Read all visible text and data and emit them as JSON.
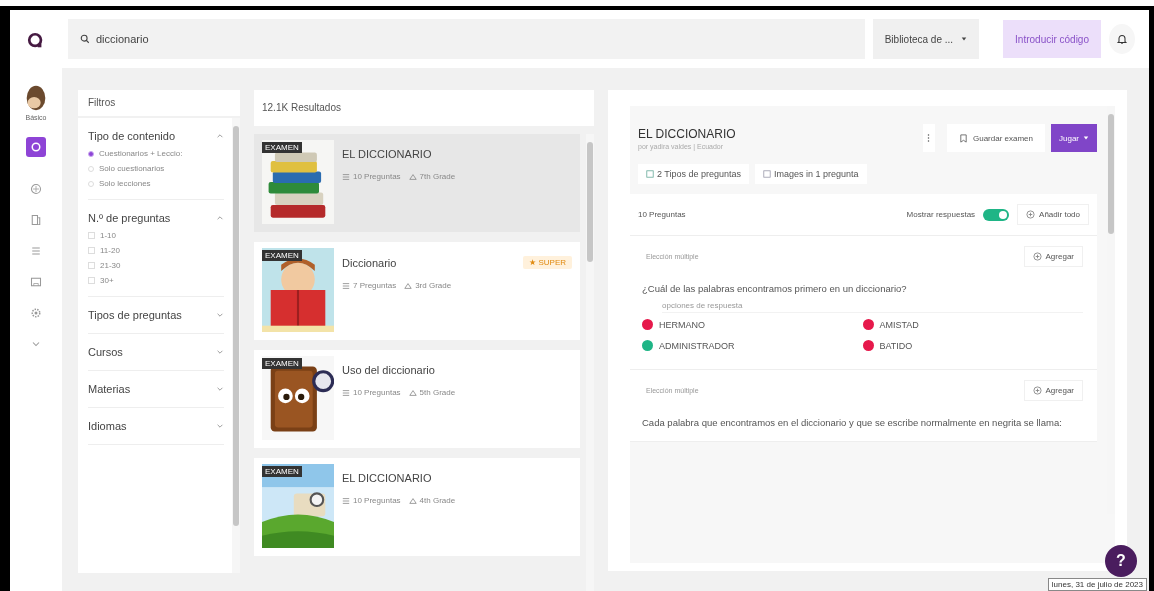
{
  "sidebar": {
    "user_label": "Básico",
    "items": [
      {
        "selected": true
      },
      {
        "selected": false
      },
      {
        "selected": false
      },
      {
        "selected": false
      },
      {
        "selected": false
      },
      {
        "selected": false
      },
      {
        "selected": false
      }
    ]
  },
  "topbar": {
    "search": {
      "value": "diccionario"
    },
    "library_dropdown": "Biblioteca de ...",
    "enter_code_button": "Introducir código"
  },
  "filters": {
    "title": "Filtros",
    "sections": [
      {
        "title": "Tipo de contenido",
        "expanded": true,
        "kind": "radio",
        "options": [
          {
            "label": "Cuestionarios + Leccio:",
            "selected": true
          },
          {
            "label": "Solo cuestionarios",
            "selected": false
          },
          {
            "label": "Solo lecciones",
            "selected": false
          }
        ]
      },
      {
        "title": "N.º de preguntas",
        "expanded": true,
        "kind": "checkbox",
        "options": [
          {
            "label": "1-10",
            "checked": false
          },
          {
            "label": "11-20",
            "checked": false
          },
          {
            "label": "21-30",
            "checked": false
          },
          {
            "label": "30+",
            "checked": false
          }
        ]
      },
      {
        "title": "Tipos de preguntas",
        "expanded": false
      },
      {
        "title": "Cursos",
        "expanded": false
      },
      {
        "title": "Materias",
        "expanded": false
      },
      {
        "title": "Idiomas",
        "expanded": false
      }
    ]
  },
  "results": {
    "count": "12.1K Resultados",
    "items": [
      {
        "title": "EL DICCIONARIO",
        "badge": "EXAMEN",
        "questions": "10 Preguntas",
        "grade": "7th Grade",
        "selected": true
      },
      {
        "title": "Diccionario",
        "badge": "EXAMEN",
        "questions": "7 Preguntas",
        "grade": "3rd Grade",
        "selected": false,
        "super": "★ SUPER"
      },
      {
        "title": "Uso del diccionario",
        "badge": "EXAMEN",
        "questions": "10 Preguntas",
        "grade": "5th Grade",
        "selected": false
      },
      {
        "title": "EL DICCIONARIO",
        "badge": "EXAMEN",
        "questions": "10 Preguntas",
        "grade": "4th Grade",
        "selected": false
      }
    ]
  },
  "detail": {
    "title": "EL DICCIONARIO",
    "author": "por yadira valdes | Ecuador",
    "save_button": "Guardar examen",
    "play_button": "Jugar",
    "chips": [
      "2 Tipos de preguntas",
      "Images in 1 pregunta"
    ],
    "question_count": "10 Preguntas",
    "show_answers": {
      "label": "Mostrar respuestas",
      "on": true
    },
    "add_all_button": "Añadir todo",
    "questions": [
      {
        "type": "Elección múltiple",
        "add_button": "Agregar",
        "text": "¿Cuál de las palabras encontramos primero en un diccionario?",
        "options_label": "opciones de respuesta",
        "options": [
          {
            "text": "HERMANO",
            "correct": false
          },
          {
            "text": "AMISTAD",
            "correct": false
          },
          {
            "text": "ADMINISTRADOR",
            "correct": true
          },
          {
            "text": "BATIDO",
            "correct": false
          }
        ]
      },
      {
        "type": "Elección múltiple",
        "add_button": "Agregar",
        "text": "Cada palabra que encontramos en el diccionario y que se escribe normalmente en negrita se llama:"
      }
    ]
  },
  "help_button": "?",
  "date_tooltip": "lunes, 31 de julio de 2023"
}
